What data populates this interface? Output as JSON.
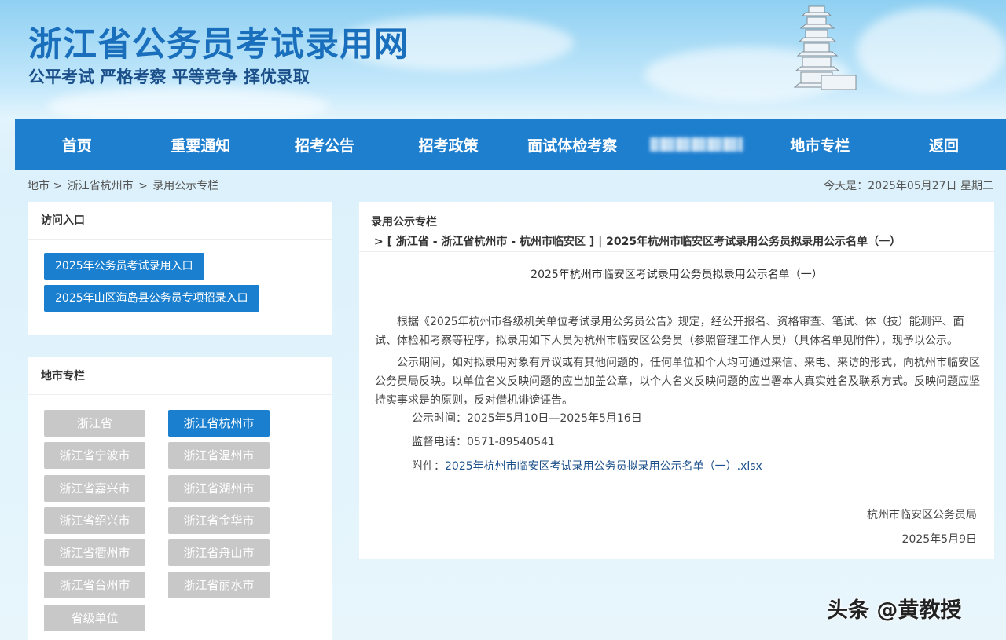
{
  "header": {
    "site_title": "浙江省公务员考试录用网",
    "slogan": "公平考试 严格考察 平等竞争 择优录取"
  },
  "nav": {
    "items": [
      "首页",
      "重要通知",
      "招考公告",
      "招考政策",
      "面试体检考察",
      "",
      "地市专栏",
      "返回"
    ],
    "blurred_index": 5
  },
  "breadcrumb": {
    "items": [
      "地市 >",
      "浙江省杭州市",
      ">",
      "录用公示专栏"
    ],
    "today": "今天是：2025年05月27日 星期二"
  },
  "access_panel": {
    "title": "访问入口",
    "buttons": [
      "2025年公务员考试录用入口",
      "2025年山区海岛县公务员专项招录入口"
    ]
  },
  "city_panel": {
    "title": "地市专栏",
    "items": [
      "浙江省",
      "浙江省杭州市",
      "浙江省宁波市",
      "浙江省温州市",
      "浙江省嘉兴市",
      "浙江省湖州市",
      "浙江省绍兴市",
      "浙江省金华市",
      "浙江省衢州市",
      "浙江省舟山市",
      "浙江省台州市",
      "浙江省丽水市",
      "省级单位"
    ],
    "active_index": 1
  },
  "main": {
    "section_title": "录用公示专栏",
    "path": "> [ 浙江省 - 浙江省杭州市 - 杭州市临安区 ] | 2025年杭州市临安区考试录用公务员拟录用公示名单（一）",
    "doc_title": "2025年杭州市临安区考试录用公务员拟录用公示名单（一）",
    "para1": "根据《2025年杭州市各级机关单位考试录用公务员公告》规定，经公开报名、资格审查、笔试、体（技）能测评、面试、体检和考察等程序，拟录用如下人员为杭州市临安区公务员（参照管理工作人员）（具体名单见附件），现予以公示。",
    "para2": "公示期间，如对拟录用对象有异议或有其他问题的，任何单位和个人均可通过来信、来电、来访的形式，向杭州市临安区公务员局反映。以单位名义反映问题的应当加盖公章，以个人名义反映问题的应当署本人真实姓名及联系方式。反映问题应坚持实事求是的原则，反对借机诽谤诬告。",
    "period_label": "公示时间：",
    "period_value": "2025年5月10日—2025年5月16日",
    "phone_label": "监督电话：",
    "phone_value": "0571-89540541",
    "attach_label": "附件：",
    "attach_value": "2025年杭州市临安区考试录用公务员拟录用公示名单（一）.xlsx",
    "signer": "杭州市临安区公务员局",
    "sign_date": "2025年5月9日"
  },
  "watermark": "头条 @黄教授",
  "colors": {
    "nav_bg": "#1f7fcf",
    "title": "#1a6fbd",
    "button_blue": "#1a7fce",
    "button_grey": "#c8c8c8"
  }
}
